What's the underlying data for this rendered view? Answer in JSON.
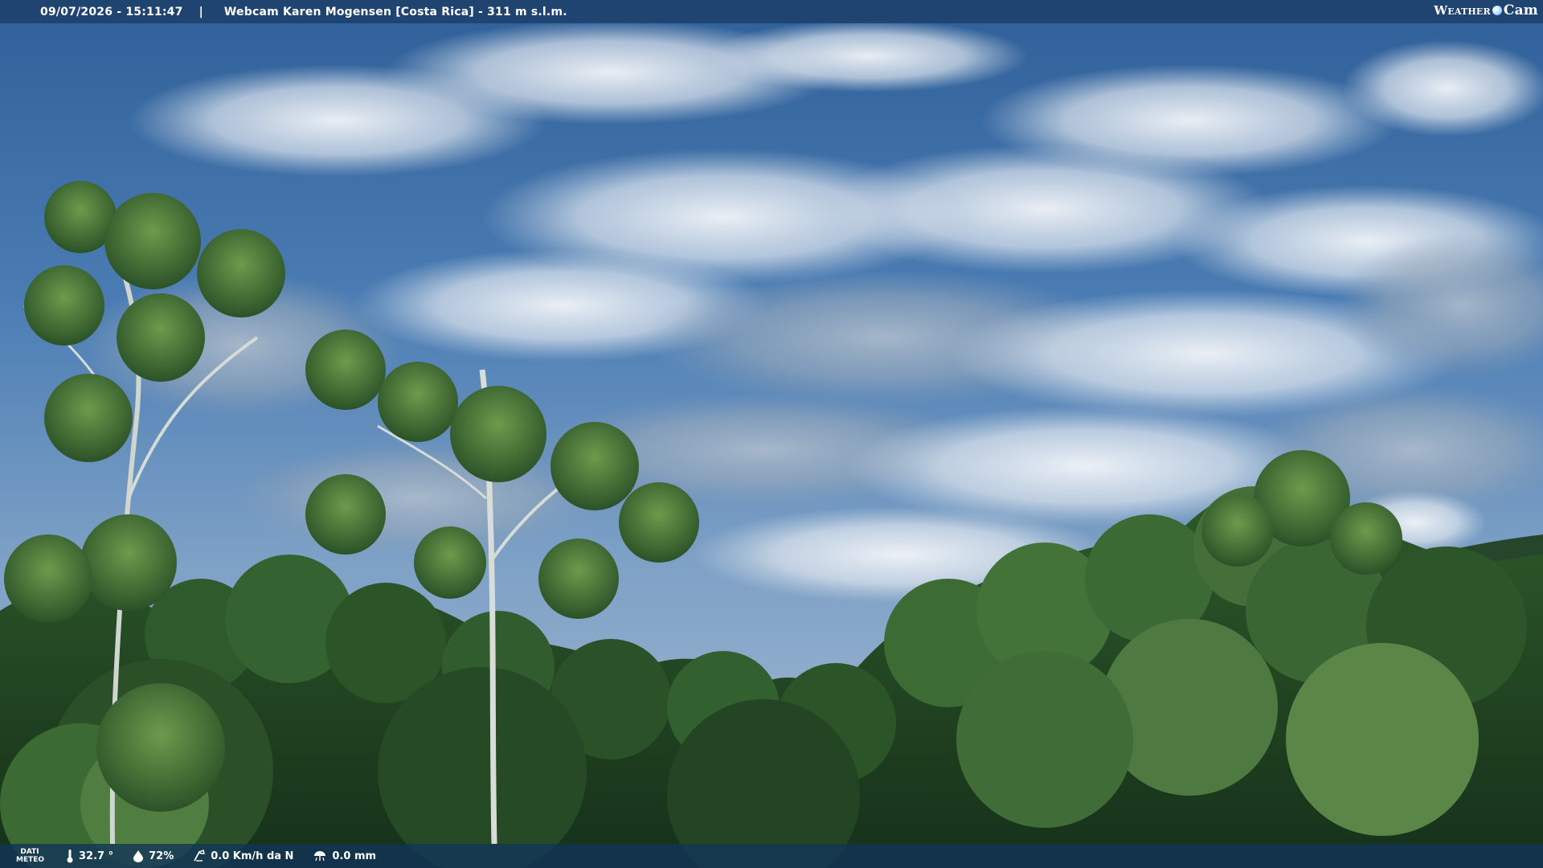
{
  "header": {
    "datetime": "09/07/2026 - 15:11:47",
    "separator": "|",
    "title": "Webcam Karen Mogensen [Costa Rica] - 311 m s.l.m."
  },
  "logo": {
    "left": "Weather",
    "right": "Cam"
  },
  "meteo": {
    "label_line1": "DATI",
    "label_line2": "METEO",
    "temperature": "32.7 °",
    "humidity": "72%",
    "wind": "0.0 Km/h da N",
    "rain": "0.0 mm"
  },
  "icons": {
    "temperature": "thermometer-icon",
    "humidity": "droplet-icon",
    "wind": "wind-icon",
    "rain": "rain-icon"
  },
  "colors": {
    "sky": "#4d7fb6",
    "bar": "#1c3e68",
    "foliage": "#2f5a2a"
  }
}
